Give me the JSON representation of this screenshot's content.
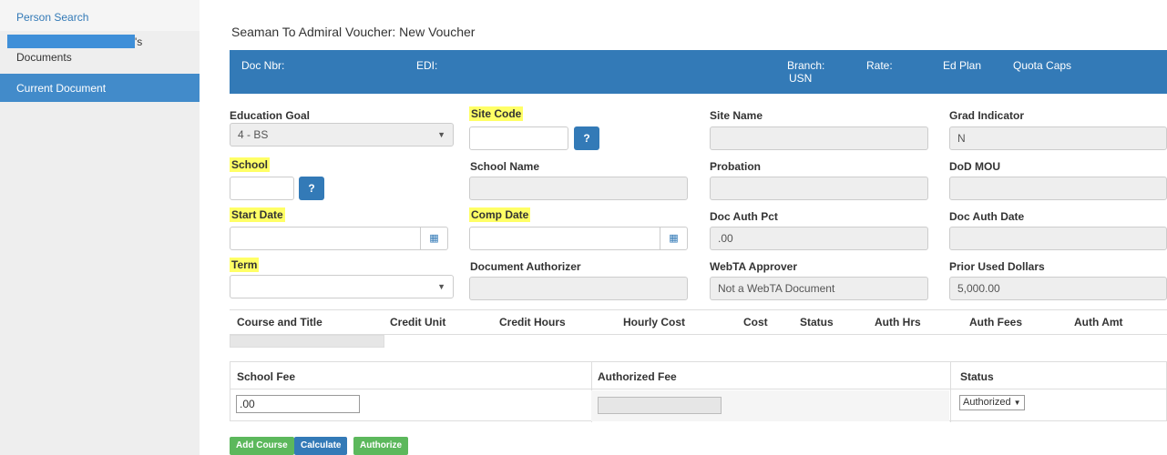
{
  "sidebar": {
    "person_search": "Person Search",
    "docs_suffix": "'s",
    "documents": "Documents",
    "current_document": "Current Document"
  },
  "page_title": "Seaman To Admiral Voucher: New Voucher",
  "banner": {
    "doc_nbr": "Doc Nbr:",
    "edi": "EDI:",
    "branch_label": "Branch:",
    "branch_value": "USN",
    "rate": "Rate:",
    "ed_plan": "Ed Plan",
    "quota_caps": "Quota Caps"
  },
  "form": {
    "education_goal": {
      "label": "Education Goal",
      "value": "4 - BS"
    },
    "site_code": {
      "label": "Site Code",
      "value": "",
      "help": "?"
    },
    "site_name": {
      "label": "Site Name",
      "value": ""
    },
    "grad_indicator": {
      "label": "Grad Indicator",
      "value": "N"
    },
    "school": {
      "label": "School",
      "value": "",
      "help": "?"
    },
    "school_name": {
      "label": "School Name",
      "value": ""
    },
    "probation": {
      "label": "Probation",
      "value": ""
    },
    "dod_mou": {
      "label": "DoD MOU",
      "value": ""
    },
    "start_date": {
      "label": "Start Date",
      "value": ""
    },
    "comp_date": {
      "label": "Comp Date",
      "value": ""
    },
    "doc_auth_pct": {
      "label": "Doc Auth Pct",
      "value": ".00"
    },
    "doc_auth_date": {
      "label": "Doc Auth Date",
      "value": ""
    },
    "term": {
      "label": "Term",
      "value": ""
    },
    "document_authorizer": {
      "label": "Document Authorizer",
      "value": ""
    },
    "webta_approver": {
      "label": "WebTA Approver",
      "value": "Not a WebTA Document"
    },
    "prior_used_dollars": {
      "label": "Prior Used Dollars",
      "value": "5,000.00"
    }
  },
  "course_table": {
    "columns": [
      "Course and Title",
      "Credit Unit",
      "Credit Hours",
      "Hourly Cost",
      "Cost",
      "Status",
      "Auth Hrs",
      "Auth Fees",
      "Auth Amt"
    ]
  },
  "fee_table": {
    "columns": [
      "School Fee",
      "Authorized Fee",
      "Status"
    ],
    "school_fee_value": ".00",
    "status_value": "Authorized"
  },
  "buttons": {
    "add_course": "Add Course",
    "calculate": "Calculate",
    "authorize": "Authorize"
  }
}
